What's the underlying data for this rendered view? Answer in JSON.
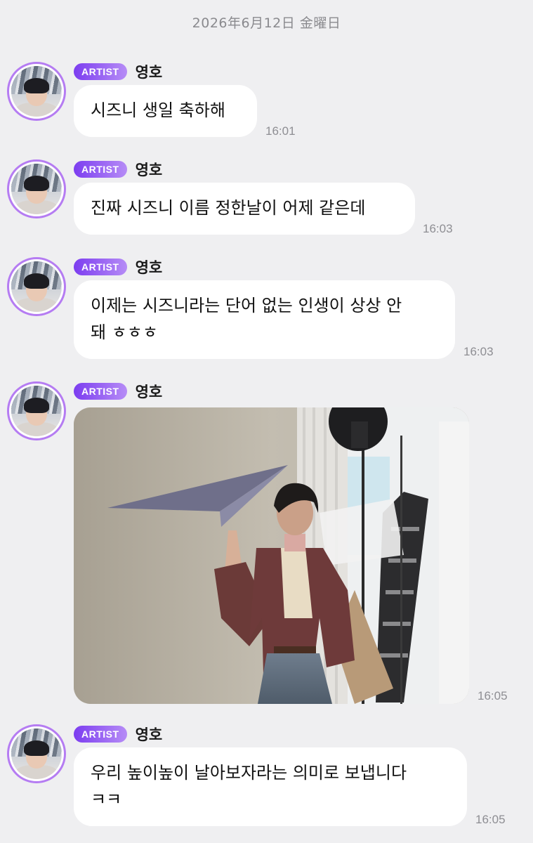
{
  "date_header": "2026年6月12日 金曜日",
  "badge_label": "ARTIST",
  "sender_name": "영호",
  "messages": [
    {
      "text": "시즈니 생일 축하해",
      "time": "16:01"
    },
    {
      "text": "진짜 시즈니 이름 정한날이 어제 같은데",
      "time": "16:03"
    },
    {
      "line1": "이제는 시즈니라는 단어 없는 인생이 상상 안",
      "line2": "돼 ㅎㅎㅎ",
      "time": "16:03"
    },
    {
      "type": "image",
      "time": "16:05"
    },
    {
      "line1": "우리 높이높이 날아보자라는 의미로 보냅니다",
      "line2": "ㅋㅋ",
      "time": "16:05"
    }
  ],
  "colors": {
    "background": "#efeff1",
    "badge_gradient_start": "#7c3df0",
    "badge_gradient_end": "#b68cf6",
    "bubble": "#ffffff",
    "timestamp": "#8e8e93"
  }
}
